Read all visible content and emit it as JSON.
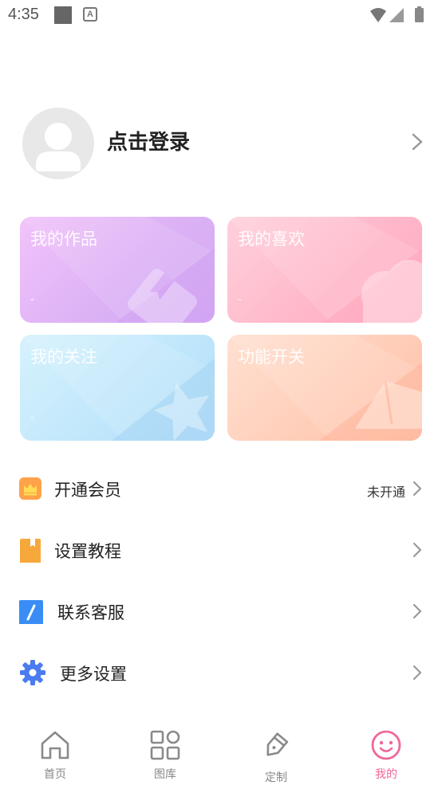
{
  "status_bar": {
    "time": "4:35",
    "icons": [
      "square-notification-icon",
      "a-notification-icon",
      "wifi-icon",
      "signal-icon",
      "battery-icon"
    ]
  },
  "profile": {
    "login_label": "点击登录"
  },
  "cards": [
    {
      "title": "我的作品",
      "sub": "-",
      "icon": "bookmark-icon"
    },
    {
      "title": "我的喜欢",
      "sub": "-",
      "icon": "cloud-icon"
    },
    {
      "title": "我的关注",
      "sub": "-",
      "icon": "star-icon"
    },
    {
      "title": "功能开关",
      "sub": "",
      "icon": "paper-plane-icon"
    }
  ],
  "menu": [
    {
      "label": "开通会员",
      "status": "未开通",
      "icon": "crown-icon",
      "color": "#ff9f43"
    },
    {
      "label": "设置教程",
      "status": "",
      "icon": "book-icon",
      "color": "#f8a93a"
    },
    {
      "label": "联系客服",
      "status": "",
      "icon": "slash-icon",
      "color": "#3d8ef7"
    },
    {
      "label": "更多设置",
      "status": "",
      "icon": "gear-icon",
      "color": "#4a7cf0"
    }
  ],
  "bottom_nav": [
    {
      "label": "首页",
      "icon": "home-icon",
      "active": false
    },
    {
      "label": "图库",
      "icon": "grid-icon",
      "active": false
    },
    {
      "label": "定制",
      "icon": "pen-icon",
      "active": false
    },
    {
      "label": "我的",
      "icon": "smiley-icon",
      "active": true
    }
  ],
  "colors": {
    "accent": "#f0679a",
    "chevron": "#999999"
  }
}
